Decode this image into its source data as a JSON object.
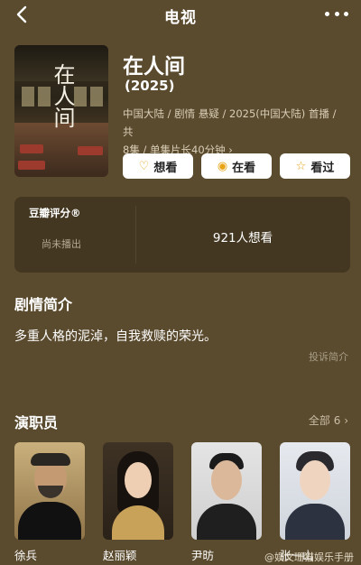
{
  "colors": {
    "background": "#5a4a2e",
    "button_bg": "#ffffff",
    "accent": "#e8a317",
    "card_bg": "#322818"
  },
  "topbar": {
    "title": "电视",
    "back_icon": "chevron-left-icon",
    "more_icon": "more-dots-icon"
  },
  "show": {
    "title": "在人间",
    "year": "(2025)",
    "meta_line1": "中国大陆 / 剧情 悬疑 / 2025(中国大陆) 首播 / 共",
    "meta_line2": "8集 / 单集片长40分钟",
    "meta_arrow": "›",
    "poster_title": "在人间"
  },
  "actions": [
    {
      "label": "想看",
      "icon": "heart-plus-icon",
      "glyph": "♡"
    },
    {
      "label": "在看",
      "icon": "eye-icon",
      "glyph": "◉"
    },
    {
      "label": "看过",
      "icon": "star-icon",
      "glyph": "☆"
    }
  ],
  "rating": {
    "label": "豆瓣评分®",
    "status": "尚未播出",
    "want_count": "921人想看"
  },
  "synopsis": {
    "title": "剧情简介",
    "text": "多重人格的泥淖，自我救赎的荣光。",
    "complain": "投诉简介"
  },
  "cast": {
    "title": "演职员",
    "all_label": "全部 6",
    "arrow": "›",
    "members": [
      {
        "name": "徐兵"
      },
      {
        "name": "赵丽颖"
      },
      {
        "name": "尹昉"
      },
      {
        "name": "张一山"
      }
    ]
  },
  "watermark": "@娱文珊猫娱乐手册"
}
